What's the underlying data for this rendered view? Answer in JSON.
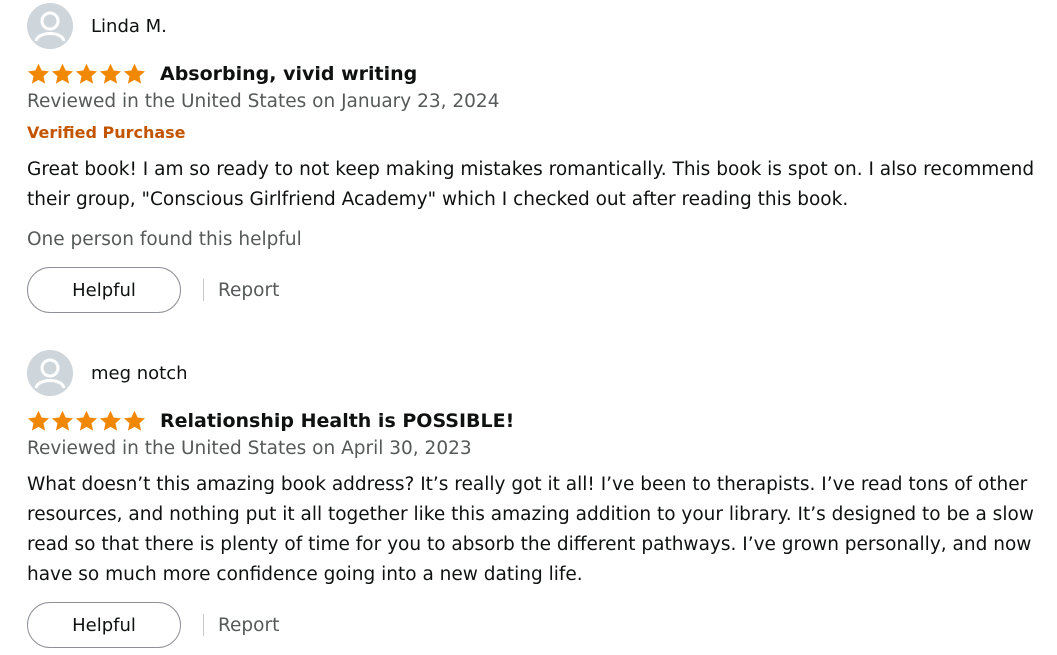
{
  "colors": {
    "star": "#f08804",
    "verified": "#c45500",
    "muted": "#565959",
    "text": "#0f1111"
  },
  "reviews": [
    {
      "reviewer": "Linda M.",
      "rating": 5,
      "title": "Absorbing, vivid writing",
      "date": "Reviewed in the United States on January 23, 2024",
      "verified": "Verified Purchase",
      "body": "Great book! I am so ready to not keep making mistakes romantically. This book is spot on. I also recommend their group, \"Conscious Girlfriend Academy\" which I checked out after reading this book.",
      "helpful_count": "One person found this helpful",
      "helpful_label": "Helpful",
      "report_label": "Report"
    },
    {
      "reviewer": "meg notch",
      "rating": 5,
      "title": "Relationship Health is POSSIBLE!",
      "date": "Reviewed in the United States on April 30, 2023",
      "body": "What doesn’t this amazing book address? It’s really got it all! I’ve been to therapists. I’ve read tons of other resources, and nothing put it all together like this amazing addition to your library. It’s designed to be a slow read so that there is plenty of time for you to absorb the different pathways. I’ve grown personally, and now have so much more confidence going into a new dating life.",
      "helpful_label": "Helpful",
      "report_label": "Report"
    }
  ]
}
